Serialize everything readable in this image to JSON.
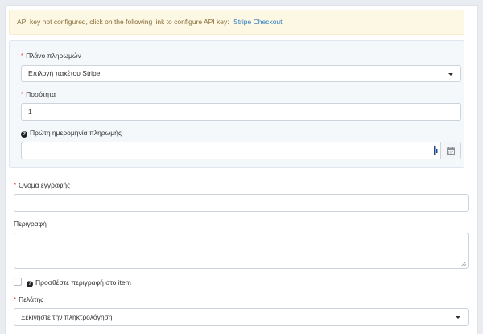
{
  "alert": {
    "message": "API key not configured, click on the following link to configure API key:",
    "link_text": "Stripe Checkout"
  },
  "stripe_section": {
    "plan": {
      "label": "Πλάνο πληρωμών",
      "required_mark": "*",
      "selected": "Επιλογή πακέτου Stripe"
    },
    "quantity": {
      "label": "Ποσότητα",
      "required_mark": "*",
      "value": "1"
    },
    "first_payment_date": {
      "label": "Πρώτη ημερομηνία πληρωμής",
      "value": "",
      "icon": "calendar-icon"
    }
  },
  "subscription_name": {
    "label": "Ονομα εγγραφής",
    "required_mark": "*",
    "value": ""
  },
  "description": {
    "label": "Περιγραφή",
    "value": ""
  },
  "add_description_checkbox": {
    "label": "Προσθέστε περιγραφή στο item",
    "checked": false
  },
  "customer": {
    "label": "Πελάτης",
    "required_mark": "*",
    "placeholder": "Ξεκινήστε την πληκτρολόγηση"
  },
  "colors": {
    "alert_bg": "#fcf8e3",
    "alert_text": "#8a6d3b",
    "link": "#2a7bbf",
    "required": "#e4463b",
    "section_bg": "#f5f8fb"
  }
}
